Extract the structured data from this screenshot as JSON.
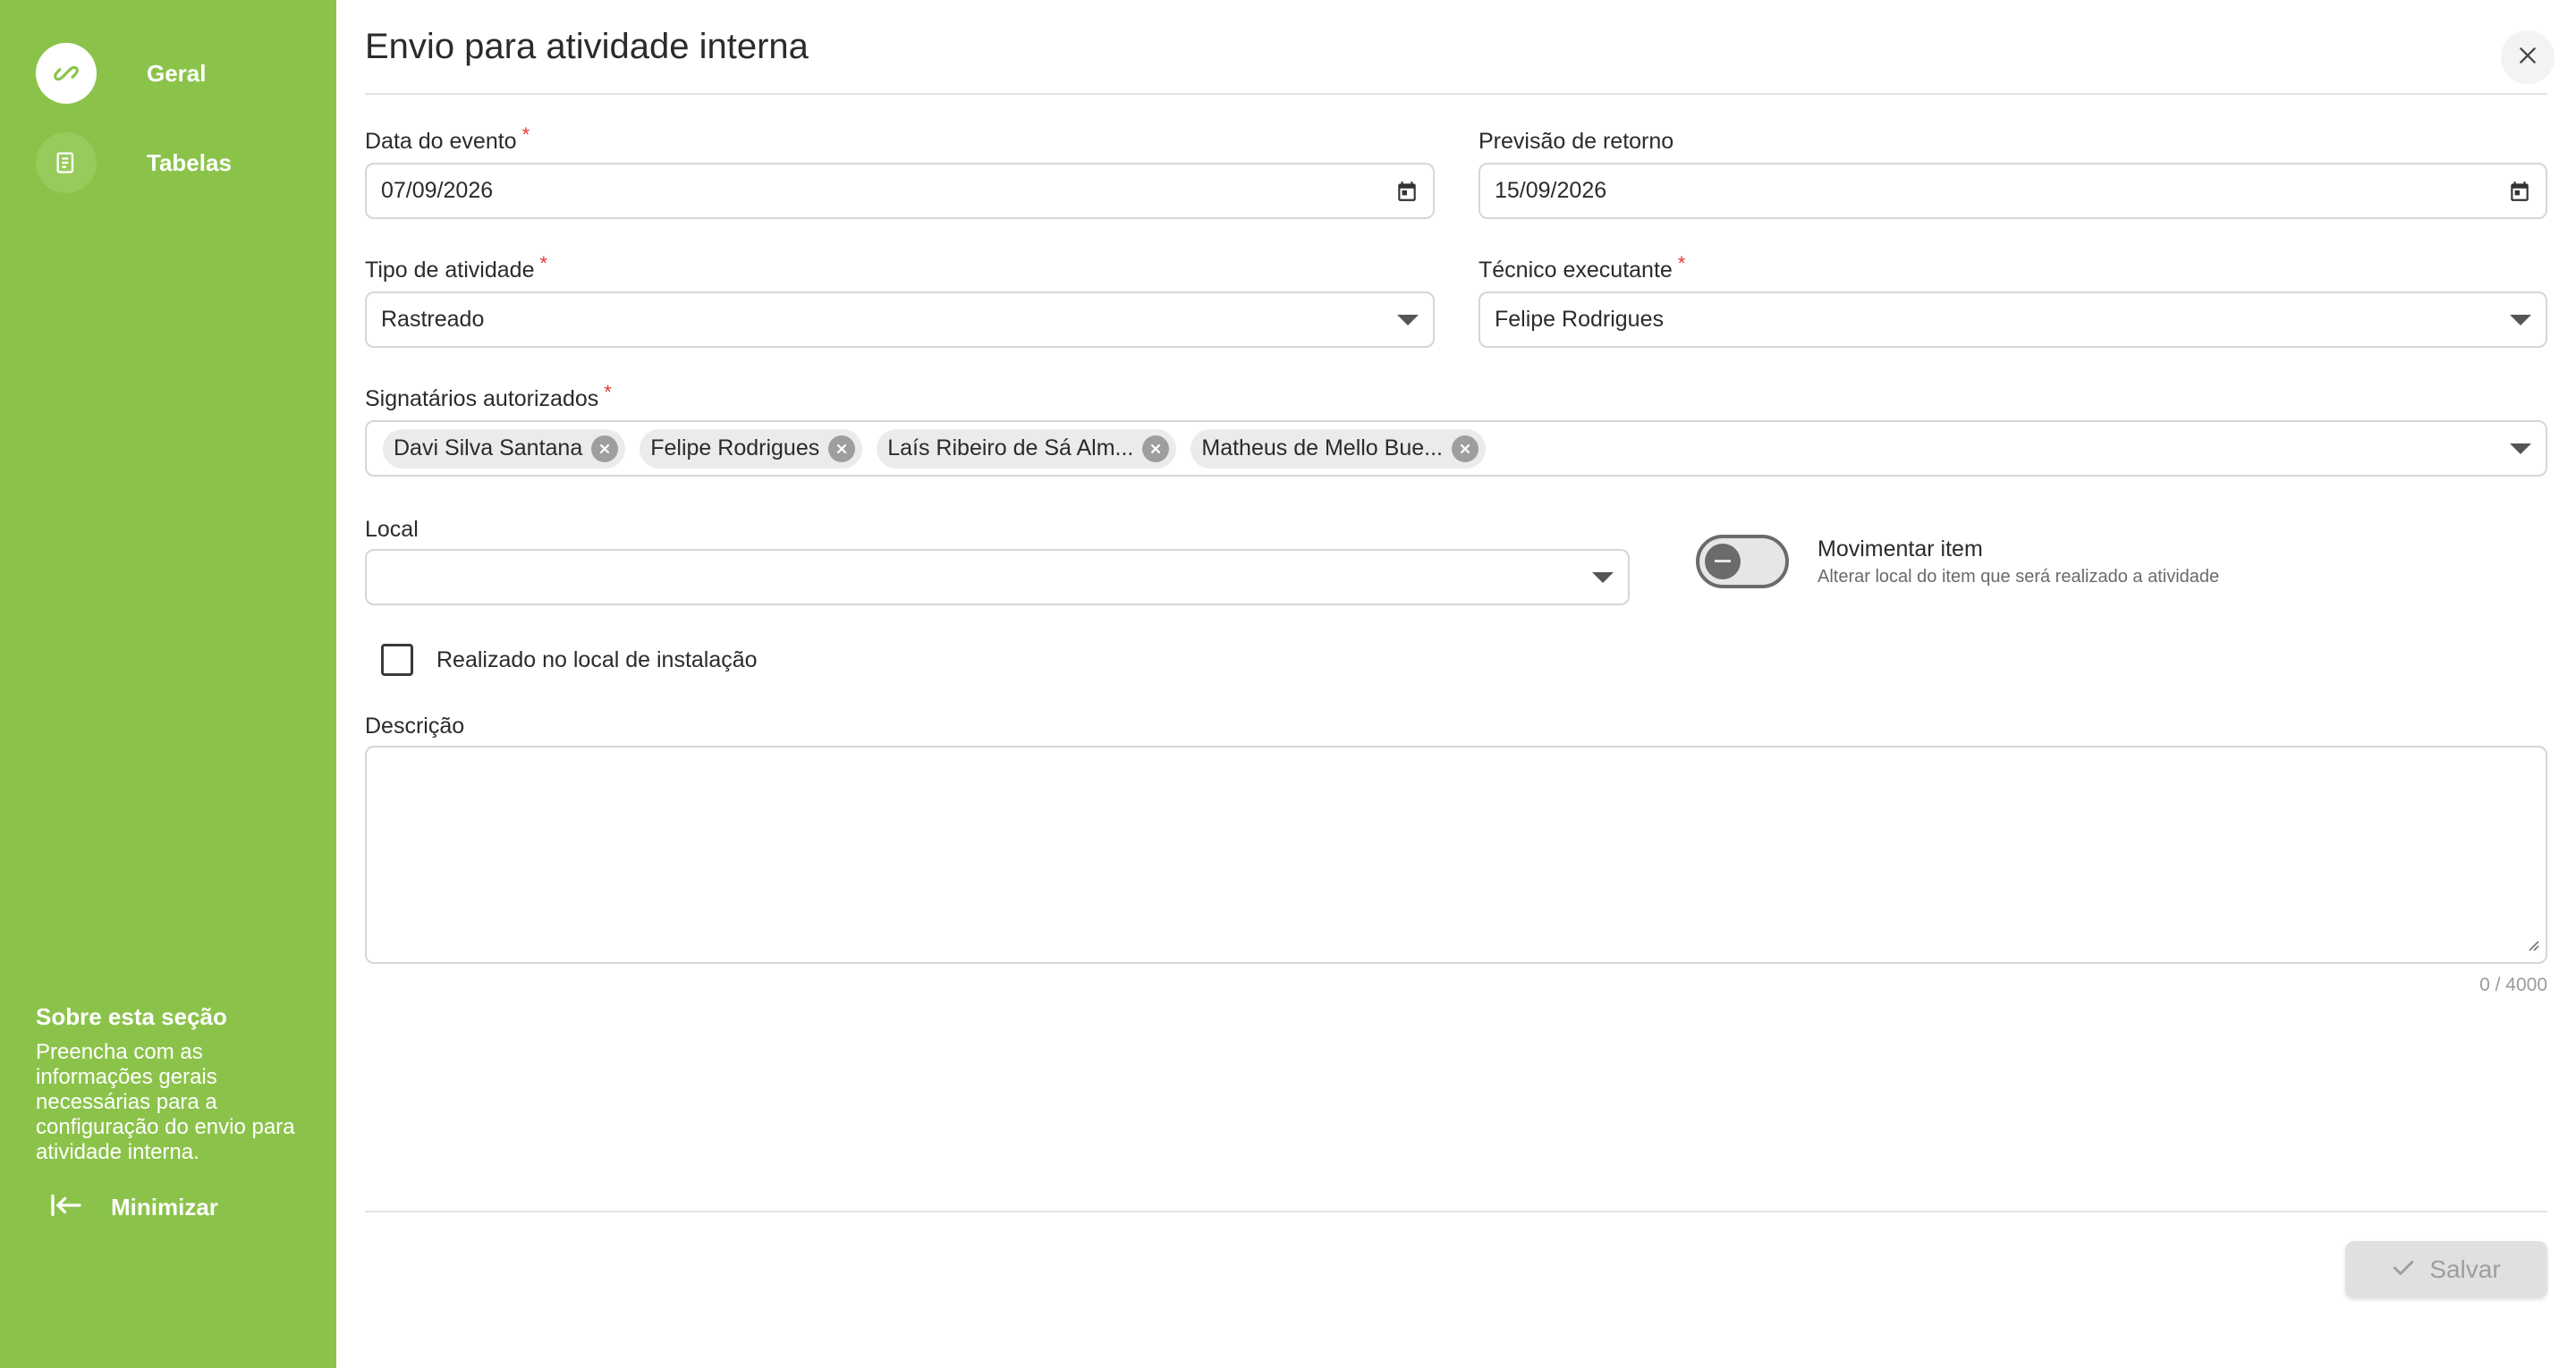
{
  "sidebar": {
    "items": [
      {
        "label": "Geral",
        "icon": "link-icon",
        "active": true
      },
      {
        "label": "Tabelas",
        "icon": "table-list-icon",
        "active": false
      }
    ],
    "about_title": "Sobre esta seção",
    "about_text": "Preencha com as informações gerais necessárias para a configuração do envio para atividade interna.",
    "minimize_label": "Minimizar"
  },
  "header": {
    "title": "Envio para atividade interna"
  },
  "form": {
    "data_evento": {
      "label": "Data do evento",
      "required_mark": "*",
      "value": "07/09/2026"
    },
    "previsao_retorno": {
      "label": "Previsão de retorno",
      "value": "15/09/2026"
    },
    "tipo_atividade": {
      "label": "Tipo de atividade",
      "required_mark": "*",
      "value": "Rastreado"
    },
    "tecnico": {
      "label": "Técnico executante",
      "required_mark": "*",
      "value": "Felipe Rodrigues"
    },
    "signatarios": {
      "label": "Signatários autorizados",
      "required_mark": "*",
      "chips": [
        "Davi Silva Santana",
        "Felipe Rodrigues",
        "Laís Ribeiro de Sá Alm...",
        "Matheus de Mello Bue..."
      ]
    },
    "local": {
      "label": "Local",
      "value": ""
    },
    "movimentar": {
      "label": "Movimentar item",
      "sublabel": "Alterar local do item que será realizado a atividade",
      "on": false
    },
    "realizado": {
      "label": "Realizado no local de instalação",
      "checked": false
    },
    "descricao": {
      "label": "Descrição",
      "value": "",
      "counter": "0 / 4000"
    }
  },
  "footer": {
    "save_label": "Salvar"
  },
  "colors": {
    "sidebar_green": "#8bc34a",
    "required_red": "#e53935"
  }
}
